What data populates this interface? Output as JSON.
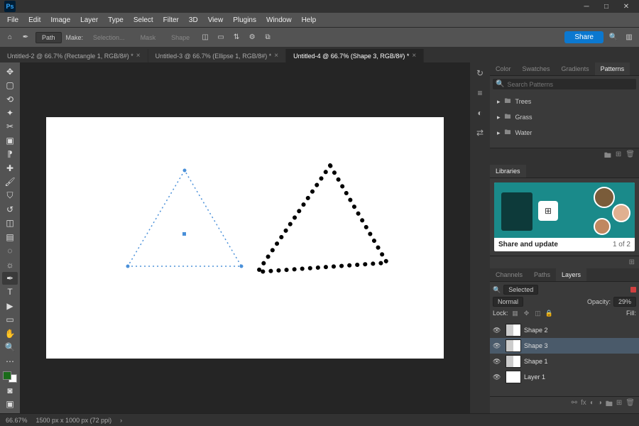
{
  "app": {
    "logo_text": "Ps"
  },
  "menu": [
    "File",
    "Edit",
    "Image",
    "Layer",
    "Type",
    "Select",
    "Filter",
    "3D",
    "View",
    "Plugins",
    "Window",
    "Help"
  ],
  "options": {
    "mode_label": "Path",
    "make_label": "Make:",
    "btn_selection": "Selection...",
    "btn_mask": "Mask",
    "btn_shape": "Shape",
    "share": "Share"
  },
  "tabs": [
    {
      "label": "Untitled-2 @ 66.7% (Rectangle 1, RGB/8#) *",
      "active": false
    },
    {
      "label": "Untitled-3 @ 66.7% (Ellipse 1, RGB/8#) *",
      "active": false
    },
    {
      "label": "Untitled-4 @ 66.7% (Shape 3, RGB/8#) *",
      "active": true
    }
  ],
  "patterns_panel": {
    "tabs": [
      "Color",
      "Swatches",
      "Gradients",
      "Patterns"
    ],
    "active_tab": "Patterns",
    "search_placeholder": "Search Patterns",
    "folders": [
      "Trees",
      "Grass",
      "Water"
    ]
  },
  "libraries_panel": {
    "tab": "Libraries",
    "card_title": "Share and update",
    "card_page": "1 of 2"
  },
  "layers_panel": {
    "tabs": [
      "Channels",
      "Paths",
      "Layers"
    ],
    "active_tab": "Layers",
    "filter_label": "Selected",
    "blend_label": "Normal",
    "opacity_label": "Opacity:",
    "opacity_value": "29%",
    "lock_label": "Lock:",
    "fill_label": "Fill:",
    "layers": [
      {
        "name": "Shape 2",
        "selected": false
      },
      {
        "name": "Shape 3",
        "selected": true
      },
      {
        "name": "Shape 1",
        "selected": false
      },
      {
        "name": "Layer 1",
        "selected": false
      }
    ]
  },
  "status": {
    "zoom": "66.67%",
    "doc": "1500 px x 1000 px (72 ppi)"
  },
  "colors": {
    "accent": "#0b78d0",
    "selection": "#4a90d9"
  }
}
